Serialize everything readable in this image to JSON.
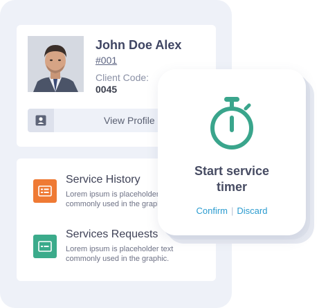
{
  "profile": {
    "name": "John Doe Alex",
    "id": "#001",
    "client_code_label": "Client Code:",
    "client_code_value": "0045",
    "view_profile_label": "View Profile"
  },
  "services": [
    {
      "title": "Service History",
      "description_line1": "Lorem ipsum is placeholder text",
      "description_line2": "commonly used in the graphic.",
      "icon": "history-card-icon",
      "color": "#ef7a34"
    },
    {
      "title": "Services Requests",
      "description_line1": "Lorem ipsum is placeholder text",
      "description_line2": "commonly used in the graphic.",
      "icon": "request-card-icon",
      "color": "#3bab8b"
    }
  ],
  "timer": {
    "title_line1": "Start service",
    "title_line2": "timer",
    "confirm_label": "Confirm",
    "separator": "|",
    "discard_label": "Discard",
    "icon": "stopwatch-icon",
    "icon_color": "#3aa58c"
  },
  "colors": {
    "panel_background": "#eef1f8",
    "name_text": "#3f4563",
    "link_blue": "#2a9bcf"
  }
}
